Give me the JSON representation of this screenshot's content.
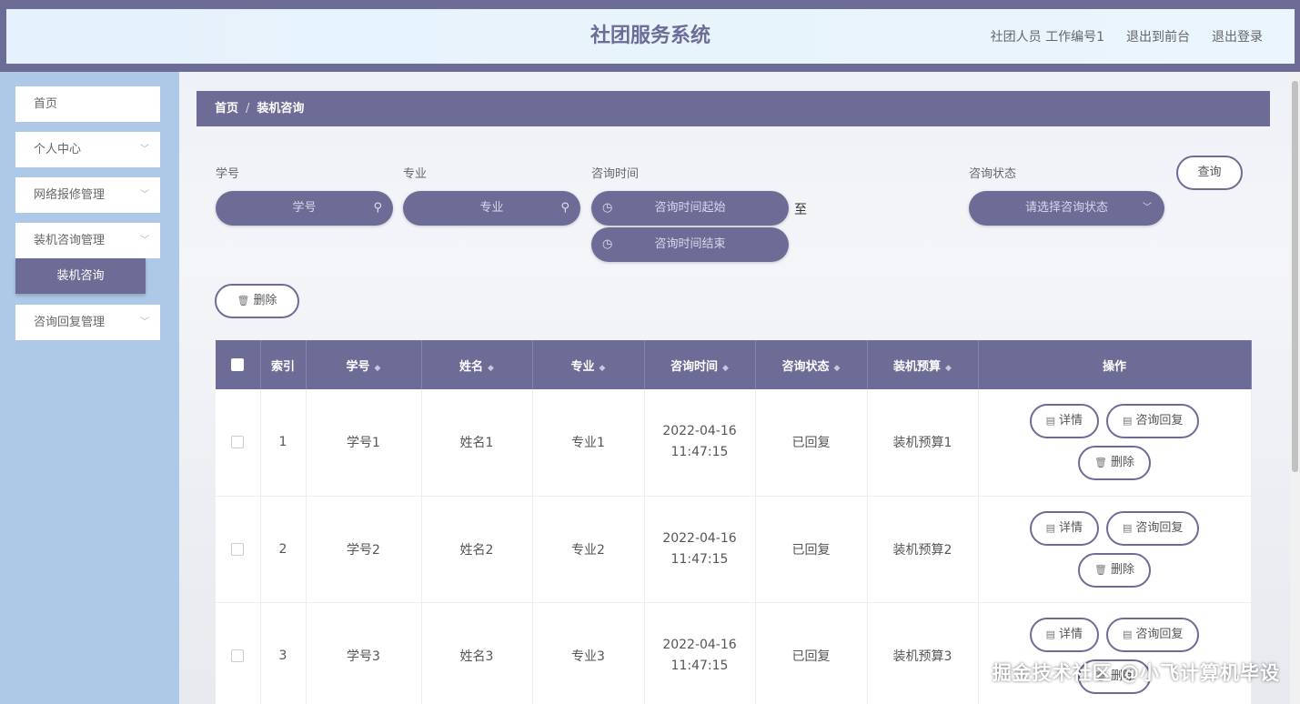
{
  "header": {
    "title": "社团服务系统",
    "user_info": "社团人员 工作编号1",
    "to_front": "退出到前台",
    "logout": "退出登录"
  },
  "sidebar": {
    "items": [
      {
        "label": "首页"
      },
      {
        "label": "个人中心"
      },
      {
        "label": "网络报修管理"
      },
      {
        "label": "装机咨询管理"
      },
      {
        "label": "咨询回复管理"
      }
    ],
    "active_sub": "装机咨询"
  },
  "breadcrumb": {
    "home": "首页",
    "sep": "/",
    "current": "装机咨询"
  },
  "filters": {
    "xuehao_label": "学号",
    "xuehao_placeholder": "学号",
    "zhuanye_label": "专业",
    "zhuanye_placeholder": "专业",
    "time_label": "咨询时间",
    "time_start_placeholder": "咨询时间起始",
    "time_end_placeholder": "咨询时间结束",
    "to_text": "至",
    "status_label": "咨询状态",
    "status_placeholder": "请选择咨询状态",
    "search_button": "查询"
  },
  "toolbar": {
    "delete_button": "删除"
  },
  "table": {
    "columns": [
      "索引",
      "学号",
      "姓名",
      "专业",
      "咨询时间",
      "咨询状态",
      "装机预算",
      "操作"
    ],
    "rows": [
      {
        "index": "1",
        "xuehao": "学号1",
        "name": "姓名1",
        "major": "专业1",
        "time": "2022-04-16 11:47:15",
        "status": "已回复",
        "budget": "装机预算1"
      },
      {
        "index": "2",
        "xuehao": "学号2",
        "name": "姓名2",
        "major": "专业2",
        "time": "2022-04-16 11:47:15",
        "status": "已回复",
        "budget": "装机预算2"
      },
      {
        "index": "3",
        "xuehao": "学号3",
        "name": "姓名3",
        "major": "专业3",
        "time": "2022-04-16 11:47:15",
        "status": "已回复",
        "budget": "装机预算3"
      }
    ],
    "ops": {
      "detail": "详情",
      "reply": "咨询回复",
      "delete": "删除"
    }
  },
  "watermark": "掘金技术社区 @小飞计算机毕设"
}
